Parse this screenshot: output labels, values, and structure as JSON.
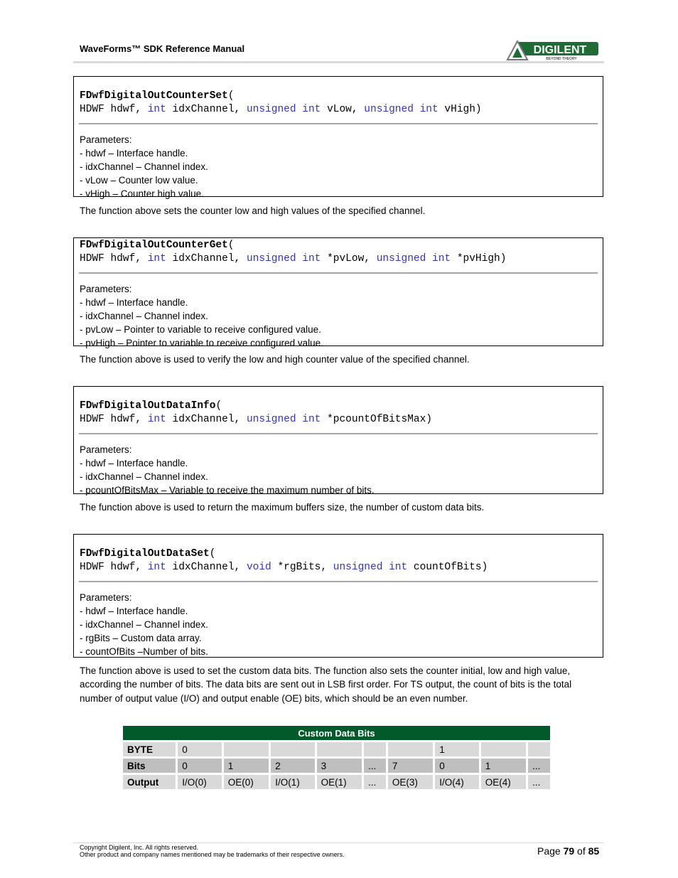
{
  "header": {
    "title": "WaveForms™ SDK Reference Manual",
    "logo_text": "DIGILENT",
    "logo_tagline": "BEYOND THEORY"
  },
  "functions": [
    {
      "name": "FDwfDigitalOutCounterSet",
      "open": "(",
      "signature": [
        {
          "t": "HDWF hdwf, "
        },
        {
          "t": "int",
          "kw": true
        },
        {
          "t": " idxChannel, "
        },
        {
          "t": "unsigned int",
          "kw": true
        },
        {
          "t": " vLow, "
        },
        {
          "t": "unsigned int",
          "kw": true
        },
        {
          "t": " vHigh)"
        }
      ],
      "params_label": "Parameters:",
      "params": [
        "- hdwf – Interface handle.",
        "- idxChannel – Channel index.",
        "- vLow – Counter low value.",
        "- vHigh – Counter high value."
      ],
      "description": "The function above sets the counter low and high values of the specified channel."
    },
    {
      "name": "FDwfDigitalOutCounterGet",
      "open": "(",
      "signature": [
        {
          "t": "HDWF hdwf, "
        },
        {
          "t": "int",
          "kw": true
        },
        {
          "t": " idxChannel, "
        },
        {
          "t": "unsigned int",
          "kw": true
        },
        {
          "t": " *pvLow, "
        },
        {
          "t": "unsigned int",
          "kw": true
        },
        {
          "t": " *pvHigh)"
        }
      ],
      "params_label": "Parameters:",
      "params": [
        "- hdwf – Interface handle.",
        "- idxChannel – Channel index.",
        "- pvLow – Pointer to variable to receive configured value.",
        "- pvHigh – Pointer to variable to receive configured value."
      ],
      "description": "The function above is used to verify the low and high counter value of the specified channel."
    },
    {
      "name": "FDwfDigitalOutDataInfo",
      "open": "(",
      "signature": [
        {
          "t": "HDWF hdwf, "
        },
        {
          "t": "int",
          "kw": true
        },
        {
          "t": " idxChannel, "
        },
        {
          "t": "unsigned int",
          "kw": true
        },
        {
          "t": " *pcountOfBitsMax)"
        }
      ],
      "params_label": "Parameters:",
      "params": [
        "- hdwf – Interface handle.",
        "- idxChannel – Channel index.",
        "- pcountOfBitsMax – Variable to receive the maximum number of bits."
      ],
      "description": "The function above is used to return the maximum buffers size, the number of custom data bits."
    },
    {
      "name": "FDwfDigitalOutDataSet",
      "open": "(",
      "signature": [
        {
          "t": "HDWF hdwf, "
        },
        {
          "t": "int",
          "kw": true
        },
        {
          "t": " idxChannel, "
        },
        {
          "t": "void",
          "kw": true
        },
        {
          "t": " *rgBits, "
        },
        {
          "t": "unsigned int",
          "kw": true
        },
        {
          "t": " countOfBits)"
        }
      ],
      "params_label": "Parameters:",
      "params": [
        "- hdwf – Interface handle.",
        "- idxChannel – Channel index.",
        "- rgBits – Custom data array.",
        "- countOfBits –Number of bits."
      ],
      "description": "The function above is used to set the custom data bits. The function also sets the counter initial, low and high value, according the number of bits. The data bits are sent out in LSB first order. For TS output, the count of bits is the total number of output value (I/O) and output enable (OE) bits, which should be an even number."
    }
  ],
  "table": {
    "title": "Custom Data Bits",
    "rows": [
      {
        "label": "BYTE",
        "cells": [
          "0",
          "",
          "",
          "",
          "",
          "",
          "1",
          "",
          ""
        ]
      },
      {
        "label": "Bits",
        "cells": [
          "0",
          "1",
          "2",
          "3",
          "...",
          "7",
          "0",
          "1",
          "..."
        ]
      },
      {
        "label": "Output",
        "cells": [
          "I/O(0)",
          "OE(0)",
          "I/O(1)",
          "OE(1)",
          "...",
          "OE(3)",
          "I/O(4)",
          "OE(4)",
          "..."
        ]
      }
    ]
  },
  "footer": {
    "copyright": "Copyright Digilent, Inc. All rights reserved.",
    "trademark": "Other product and company names mentioned may be trademarks of their respective owners.",
    "page_prefix": "Page ",
    "page_number": "79",
    "page_mid": " of ",
    "page_total": "85"
  }
}
